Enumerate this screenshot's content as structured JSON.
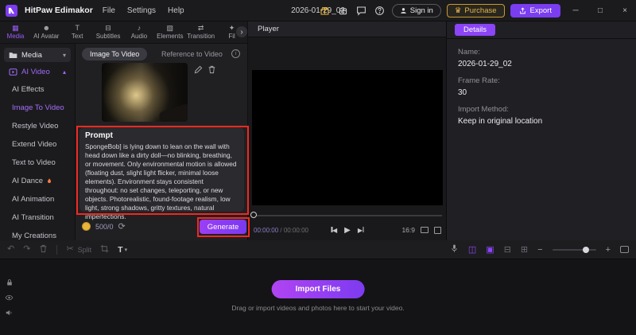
{
  "icons": {
    "chevron_down": "▾",
    "chevron_up": "▴",
    "scroll_right": "›",
    "undo": "↶",
    "redo": "↷",
    "scissors": "✂",
    "refresh": "⟳",
    "minimize": "─",
    "maximize": "□",
    "close": "×",
    "prev": "◀",
    "play": "▶",
    "next": "▶",
    "minus": "−",
    "plus": "+",
    "crown": "♛",
    "info": "i",
    "track_a": "◫",
    "track_b": "▣",
    "grid_a": "⊟",
    "grid_b": "⊞",
    "caret": "▾"
  },
  "titlebar": {
    "app_name": "HitPaw Edimakor",
    "menus": [
      "File",
      "Settings",
      "Help"
    ],
    "project_title": "2026-01-29_02",
    "sign_in_label": "Sign in",
    "purchase_label": "Purchase",
    "export_label": "Export"
  },
  "tabs": [
    {
      "icon": "▦",
      "label": "Media"
    },
    {
      "icon": "☻",
      "label": "AI Avatar"
    },
    {
      "icon": "T",
      "label": "Text"
    },
    {
      "icon": "⊟",
      "label": "Subtitles"
    },
    {
      "icon": "♪",
      "label": "Audio"
    },
    {
      "icon": "▧",
      "label": "Elements"
    },
    {
      "icon": "⇄",
      "label": "Transition"
    },
    {
      "icon": "✦",
      "label": "Fil"
    }
  ],
  "sidebar": {
    "media_group": "Media",
    "ai_video_group": "AI Video",
    "items": [
      {
        "label": "AI Effects"
      },
      {
        "label": "Image To Video"
      },
      {
        "label": "Restyle Video"
      },
      {
        "label": "Extend Video"
      },
      {
        "label": "Text to Video"
      },
      {
        "label": "AI Dance"
      },
      {
        "label": "AI Animation"
      },
      {
        "label": "AI Transition"
      },
      {
        "label": "My Creations"
      }
    ]
  },
  "generator": {
    "mode_image": "Image To Video",
    "mode_reference": "Reference to Video",
    "prompt_label": "Prompt",
    "prompt_text": "SpongeBob] is lying down to lean on the wall with head down like a dirty doll—no blinking, breathing, or movement. Only environmental motion is allowed (floating dust, slight light flicker, minimal loose elements). Environment stays consistent throughout: no set changes, teleporting, or new objects. Photorealistic, found-footage realism, low light, strong shadows, gritty textures, natural imperfections.",
    "credits": "500/0",
    "generate_label": "Generate"
  },
  "player": {
    "title": "Player",
    "current_time": "00:00:00",
    "total_time": "/ 00:00:00",
    "ratio": "16:9"
  },
  "details": {
    "tab_label": "Details",
    "name_label": "Name:",
    "name_value": "2026-01-29_02",
    "framerate_label": "Frame Rate:",
    "framerate_value": "30",
    "import_label": "Import Method:",
    "import_value": "Keep in original location"
  },
  "toolbar": {
    "split_label": "Split",
    "text_tool": "T"
  },
  "timeline": {
    "import_button": "Import Files",
    "hint": "Drag or import videos and photos here to start your video."
  },
  "colors": {
    "accent": "#8b45f7",
    "annotation": "#f2291f",
    "purchase": "#e8b53a"
  }
}
